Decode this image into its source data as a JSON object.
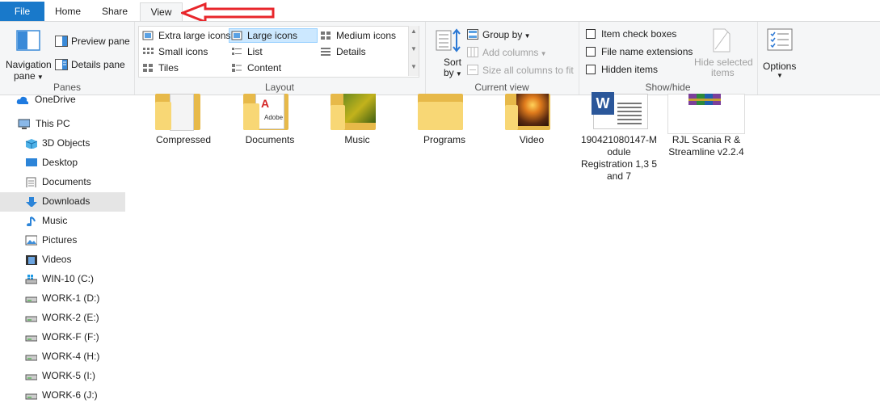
{
  "tabs": [
    {
      "label": "File"
    },
    {
      "label": "Home"
    },
    {
      "label": "Share"
    },
    {
      "label": "View"
    }
  ],
  "ribbon": {
    "panes": {
      "label": "Panes",
      "navigation_pane_line1": "Navigation",
      "navigation_pane_line2": "pane",
      "preview_pane": "Preview pane",
      "details_pane": "Details pane"
    },
    "layout": {
      "label": "Layout",
      "options": [
        "Extra large icons",
        "Large icons",
        "Medium icons",
        "Small icons",
        "List",
        "Details",
        "Tiles",
        "Content"
      ],
      "selected": "Large icons"
    },
    "current_view": {
      "label": "Current view",
      "sort_by_line1": "Sort",
      "sort_by_line2": "by",
      "group_by": "Group by",
      "add_columns": "Add columns",
      "size_all_columns": "Size all columns to fit"
    },
    "show_hide": {
      "label": "Show/hide",
      "item_check_boxes": "Item check boxes",
      "file_name_extensions": "File name extensions",
      "hidden_items": "Hidden items",
      "hide_selected_line1": "Hide selected",
      "hide_selected_line2": "items"
    },
    "options": {
      "label": "Options"
    }
  },
  "nav": {
    "items": [
      {
        "label": "OneDrive"
      },
      {
        "label": "This PC"
      },
      {
        "label": "3D Objects"
      },
      {
        "label": "Desktop"
      },
      {
        "label": "Documents"
      },
      {
        "label": "Downloads"
      },
      {
        "label": "Music"
      },
      {
        "label": "Pictures"
      },
      {
        "label": "Videos"
      },
      {
        "label": "WIN-10 (C:)"
      },
      {
        "label": "WORK-1 (D:)"
      },
      {
        "label": "WORK-2 (E:)"
      },
      {
        "label": "WORK-F (F:)"
      },
      {
        "label": "WORK-4 (H:)"
      },
      {
        "label": "WORK-5 (I:)"
      },
      {
        "label": "WORK-6 (J:)"
      }
    ],
    "selected": "Downloads"
  },
  "files": [
    {
      "label": "Compressed"
    },
    {
      "label": "Documents",
      "overlay": "Adobe"
    },
    {
      "label": "Music"
    },
    {
      "label": "Programs"
    },
    {
      "label": "Video"
    },
    {
      "label_lines": [
        "190421080147-M",
        "odule",
        "Registration 1,3 5",
        "and 7"
      ],
      "overlay": "W"
    },
    {
      "label_lines": [
        "RJL Scania R &",
        "Streamline v2.2.4"
      ]
    }
  ],
  "colors": {
    "accent": "#1979ca",
    "selection": "#cce8ff",
    "folder": "#f8d775",
    "annotation_arrow": "#e8262b"
  }
}
